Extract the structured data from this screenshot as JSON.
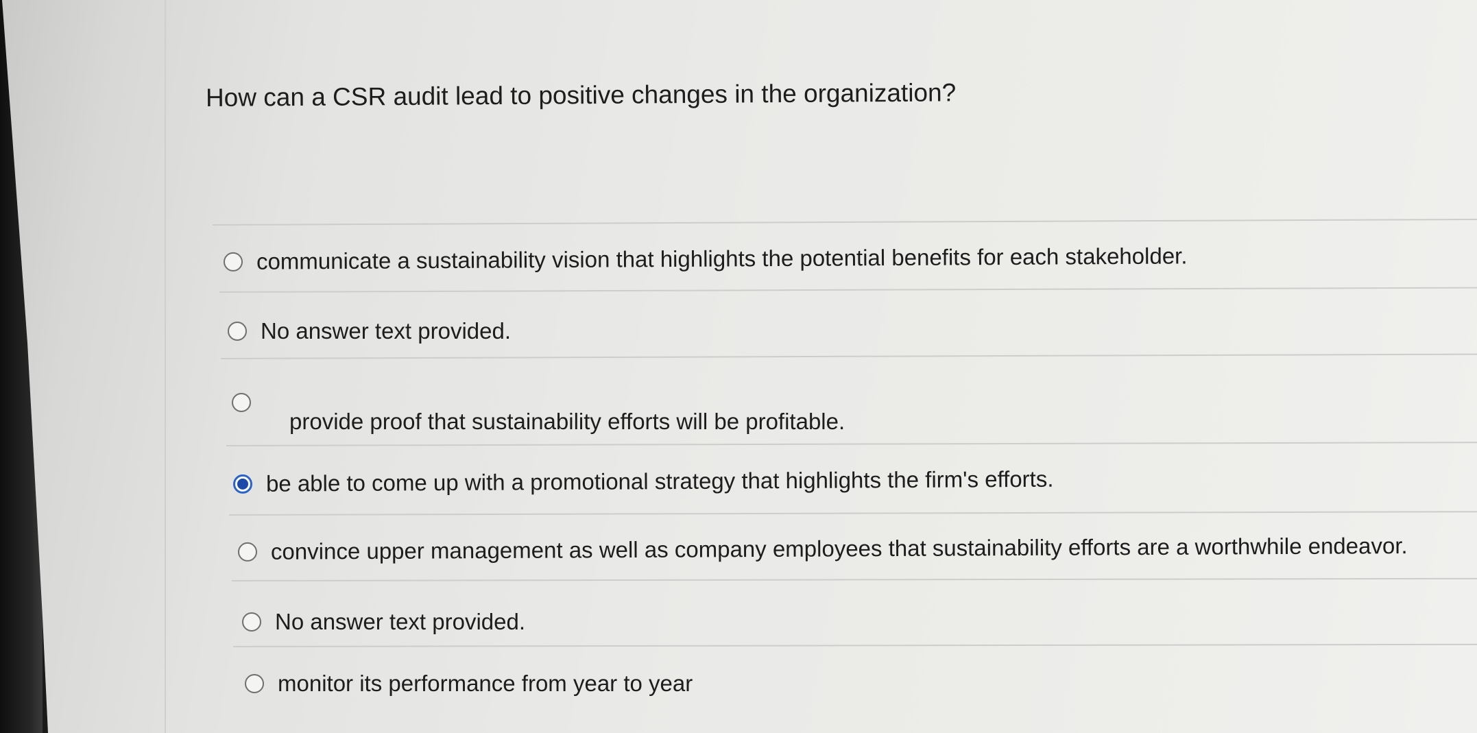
{
  "question": {
    "text": "How can a CSR audit lead to positive changes in the organization?"
  },
  "options": [
    {
      "label": "communicate a sustainability vision that highlights the potential benefits for each stakeholder.",
      "selected": false
    },
    {
      "label": "No answer text provided.",
      "selected": false
    },
    {
      "label": "provide proof that sustainability efforts will be profitable.",
      "selected": false
    },
    {
      "label": "be able to come up with a promotional strategy that highlights the firm's efforts.",
      "selected": true
    },
    {
      "label": "convince upper management as well as company employees that sustainability efforts are a worthwhile endeavor.",
      "selected": false
    },
    {
      "label": "No answer text provided.",
      "selected": false
    },
    {
      "label": "monitor its performance from year to year",
      "selected": false
    }
  ],
  "colors": {
    "selected_radio": "#1b4aa8",
    "text": "#1d1d1d"
  }
}
